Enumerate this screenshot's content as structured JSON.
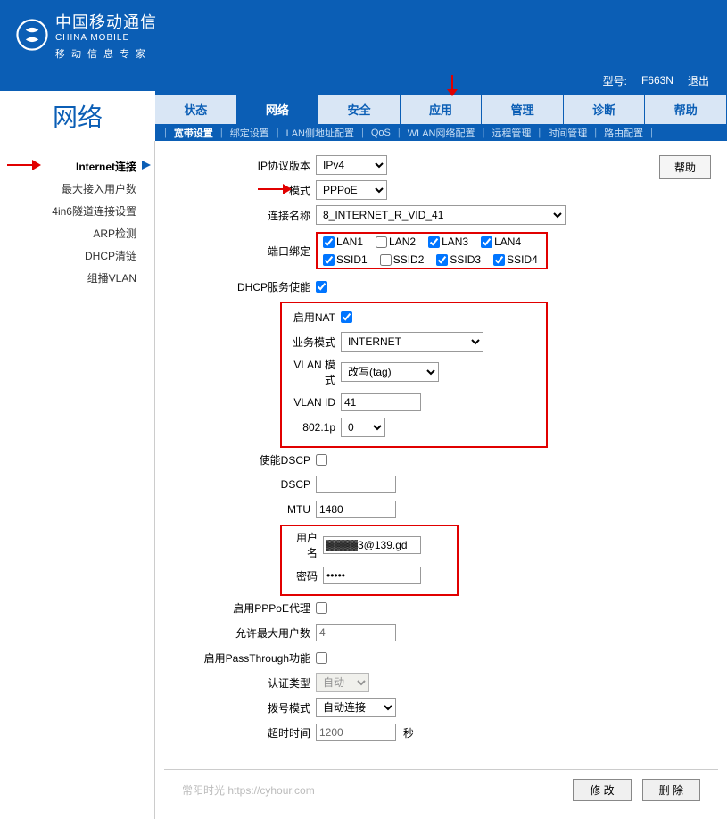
{
  "brand": {
    "cn": "中国移动通信",
    "en": "CHINA MOBILE",
    "sub": "移动信息专家"
  },
  "modelbar": {
    "model_label": "型号:",
    "model_value": "F663N",
    "logout": "退出"
  },
  "page_title": "网络",
  "tabs": [
    "状态",
    "网络",
    "安全",
    "应用",
    "管理",
    "诊断",
    "帮助"
  ],
  "active_tab": 1,
  "subtabs": [
    "宽带设置",
    "绑定设置",
    "LAN侧地址配置",
    "QoS",
    "WLAN网络配置",
    "远程管理",
    "时间管理",
    "路由配置"
  ],
  "active_subtab": 0,
  "sidebar": {
    "items": [
      "Internet连接",
      "最大接入用户数",
      "4in6隧道连接设置",
      "ARP检测",
      "DHCP清链",
      "组播VLAN"
    ],
    "active": 0
  },
  "help_label": "帮助",
  "form": {
    "ip_version": {
      "label": "IP协议版本",
      "value": "IPv4"
    },
    "mode": {
      "label": "模式",
      "value": "PPPoE"
    },
    "conn_name": {
      "label": "连接名称",
      "value": "8_INTERNET_R_VID_41"
    },
    "port_bind": {
      "label": "端口绑定",
      "lan": [
        "LAN1",
        "LAN2",
        "LAN3",
        "LAN4"
      ],
      "lan_checked": [
        true,
        false,
        true,
        true
      ],
      "ssid": [
        "SSID1",
        "SSID2",
        "SSID3",
        "SSID4"
      ],
      "ssid_checked": [
        true,
        false,
        true,
        true
      ]
    },
    "dhcp_enable": {
      "label": "DHCP服务使能",
      "checked": true
    },
    "nat_enable": {
      "label": "启用NAT",
      "checked": true
    },
    "service_mode": {
      "label": "业务模式",
      "value": "INTERNET"
    },
    "vlan_mode": {
      "label": "VLAN 模式",
      "value": "改写(tag)"
    },
    "vlan_id": {
      "label": "VLAN ID",
      "value": "41"
    },
    "dot1p": {
      "label": "802.1p",
      "value": "0"
    },
    "dscp_enable": {
      "label": "使能DSCP",
      "checked": false
    },
    "dscp": {
      "label": "DSCP",
      "value": ""
    },
    "mtu": {
      "label": "MTU",
      "value": "1480"
    },
    "username": {
      "label": "用户名",
      "value": "▓▓▓▓3@139.gd"
    },
    "password": {
      "label": "密码",
      "value": "•••••"
    },
    "pppoe_proxy": {
      "label": "启用PPPoE代理",
      "checked": false
    },
    "max_users": {
      "label": "允许最大用户数",
      "value": "4"
    },
    "passthrough": {
      "label": "启用PassThrough功能",
      "checked": false
    },
    "auth_type": {
      "label": "认证类型",
      "value": "自动"
    },
    "dial_mode": {
      "label": "拨号模式",
      "value": "自动连接"
    },
    "timeout": {
      "label": "超时时间",
      "value": "1200",
      "unit": "秒"
    }
  },
  "footer": {
    "watermark": "常阳时光 https://cyhour.com",
    "modify": "修  改",
    "delete": "删  除"
  }
}
